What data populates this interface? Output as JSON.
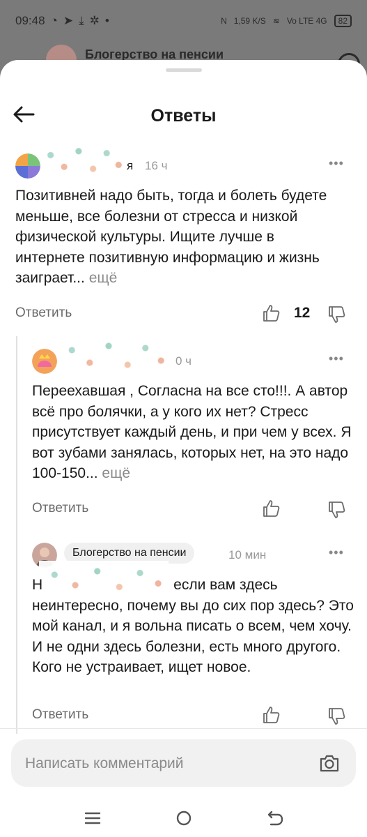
{
  "status_bar": {
    "time": "09:48",
    "speed": "1,59 K/S",
    "network": "Vo LTE 4G",
    "battery": "82"
  },
  "background_header": {
    "title": "Блогерство на пенсии"
  },
  "sheet": {
    "title": "Ответы"
  },
  "comments": [
    {
      "author": "я",
      "time": "16 ч",
      "text": "Позитивней надо быть, тогда и болеть будете меньше, все болезни от стресса и низкой физической культуры. Ищите лучше в интернете позитивную информацию и жизнь заиграет...",
      "more": "ещё",
      "reply_label": "Ответить",
      "likes": "12"
    },
    {
      "author": "",
      "time": "0 ч",
      "text": "Переехавшая , Согласна на  все сто!!!. А автор всё про болячки, а у кого их нет? Стресс присутствует каждый день, и при чем у всех. Я вот зубами занялась, которых нет, на это надо 100-150...",
      "more": "ещё",
      "reply_label": "Ответить"
    },
    {
      "author": "Блогерство на пенсии",
      "time": "10 мин",
      "text_prefix": "Н",
      "text": "если вам здесь неинтересно, почему вы до сих пор здесь? Это мой канал, и я вольна писать о всем, чем хочу. И не одни здесь болезни, есть много другого. Кого не устраивает, ищет новое.",
      "reply_label": "Ответить"
    }
  ],
  "input": {
    "placeholder": "Написать комментарий"
  },
  "icons": {
    "back": "arrow-left-icon",
    "more": "more-dots-icon",
    "like": "thumb-up-icon",
    "dislike": "thumb-down-icon",
    "camera": "camera-icon",
    "menu": "menu-icon",
    "home": "home-circle-icon",
    "back_nav": "back-nav-icon"
  }
}
